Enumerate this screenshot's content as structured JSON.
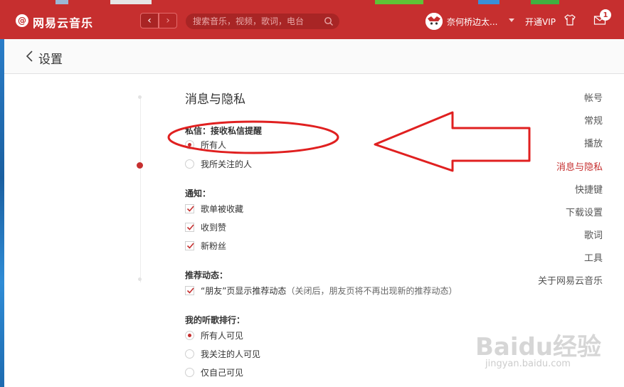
{
  "app": {
    "title": "网易云音乐",
    "logo_glyph": "@"
  },
  "toolbar": {
    "back_glyph": "‹",
    "forward_glyph": "›",
    "search_placeholder": "搜索音乐，视频，歌词，电台",
    "username": "奈何桥边太...",
    "vip_label": "开通VIP",
    "mail_badge": "1"
  },
  "header": {
    "title": "设置"
  },
  "sidebar": {
    "items": [
      {
        "label": "帐号",
        "active": false
      },
      {
        "label": "常规",
        "active": false
      },
      {
        "label": "播放",
        "active": false
      },
      {
        "label": "消息与隐私",
        "active": true
      },
      {
        "label": "快捷键",
        "active": false
      },
      {
        "label": "下载设置",
        "active": false
      },
      {
        "label": "歌词",
        "active": false
      },
      {
        "label": "工具",
        "active": false
      },
      {
        "label": "关于网易云音乐",
        "active": false
      }
    ]
  },
  "content": {
    "section_title": "消息与隐私",
    "private_msg": {
      "label": "私信：接收私信提醒",
      "options": [
        {
          "label": "所有人",
          "selected": true
        },
        {
          "label": "我所关注的人",
          "selected": false
        }
      ]
    },
    "notify": {
      "label": "通知：",
      "options": [
        {
          "label": "歌单被收藏",
          "checked": true
        },
        {
          "label": "收到赞",
          "checked": true
        },
        {
          "label": "新粉丝",
          "checked": true
        }
      ]
    },
    "recommend": {
      "label": "推荐动态：",
      "option": {
        "label": "“朋友”页显示推荐动态",
        "note": "（关闭后，朋友页将不再出现新的推荐动态）",
        "checked": true
      }
    },
    "ranking": {
      "label": "我的听歌排行：",
      "options": [
        {
          "label": "所有人可见",
          "selected": true
        },
        {
          "label": "我关注的人可见",
          "selected": false
        },
        {
          "label": "仅自己可见",
          "selected": false
        }
      ]
    }
  },
  "watermark": {
    "brand": "Baidu经验",
    "url": "jingyan.baidu.com"
  },
  "colors": {
    "accent": "#c62f2f",
    "annotation": "#e02020"
  }
}
